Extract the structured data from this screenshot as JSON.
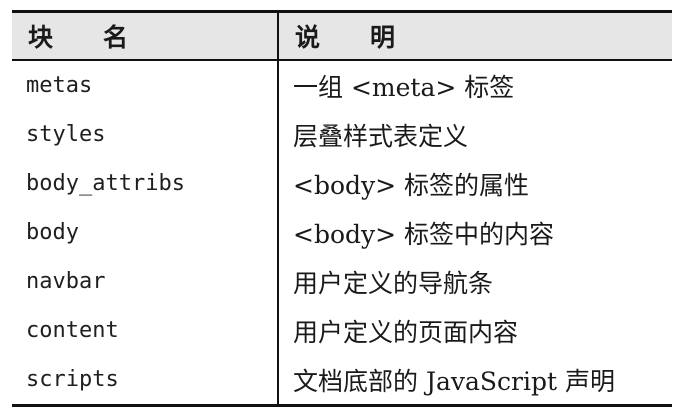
{
  "table": {
    "headers": [
      "块　　名",
      "说　　明"
    ],
    "rows": [
      {
        "name": "metas",
        "desc": "一组 <meta> 标签"
      },
      {
        "name": "styles",
        "desc": "层叠样式表定义"
      },
      {
        "name": "body_attribs",
        "desc": "<body> 标签的属性"
      },
      {
        "name": "body",
        "desc": "<body> 标签中的内容"
      },
      {
        "name": "navbar",
        "desc": "用户定义的导航条"
      },
      {
        "name": "content",
        "desc": "用户定义的页面内容"
      },
      {
        "name": "scripts",
        "desc": "文档底部的 JavaScript 声明"
      }
    ]
  }
}
